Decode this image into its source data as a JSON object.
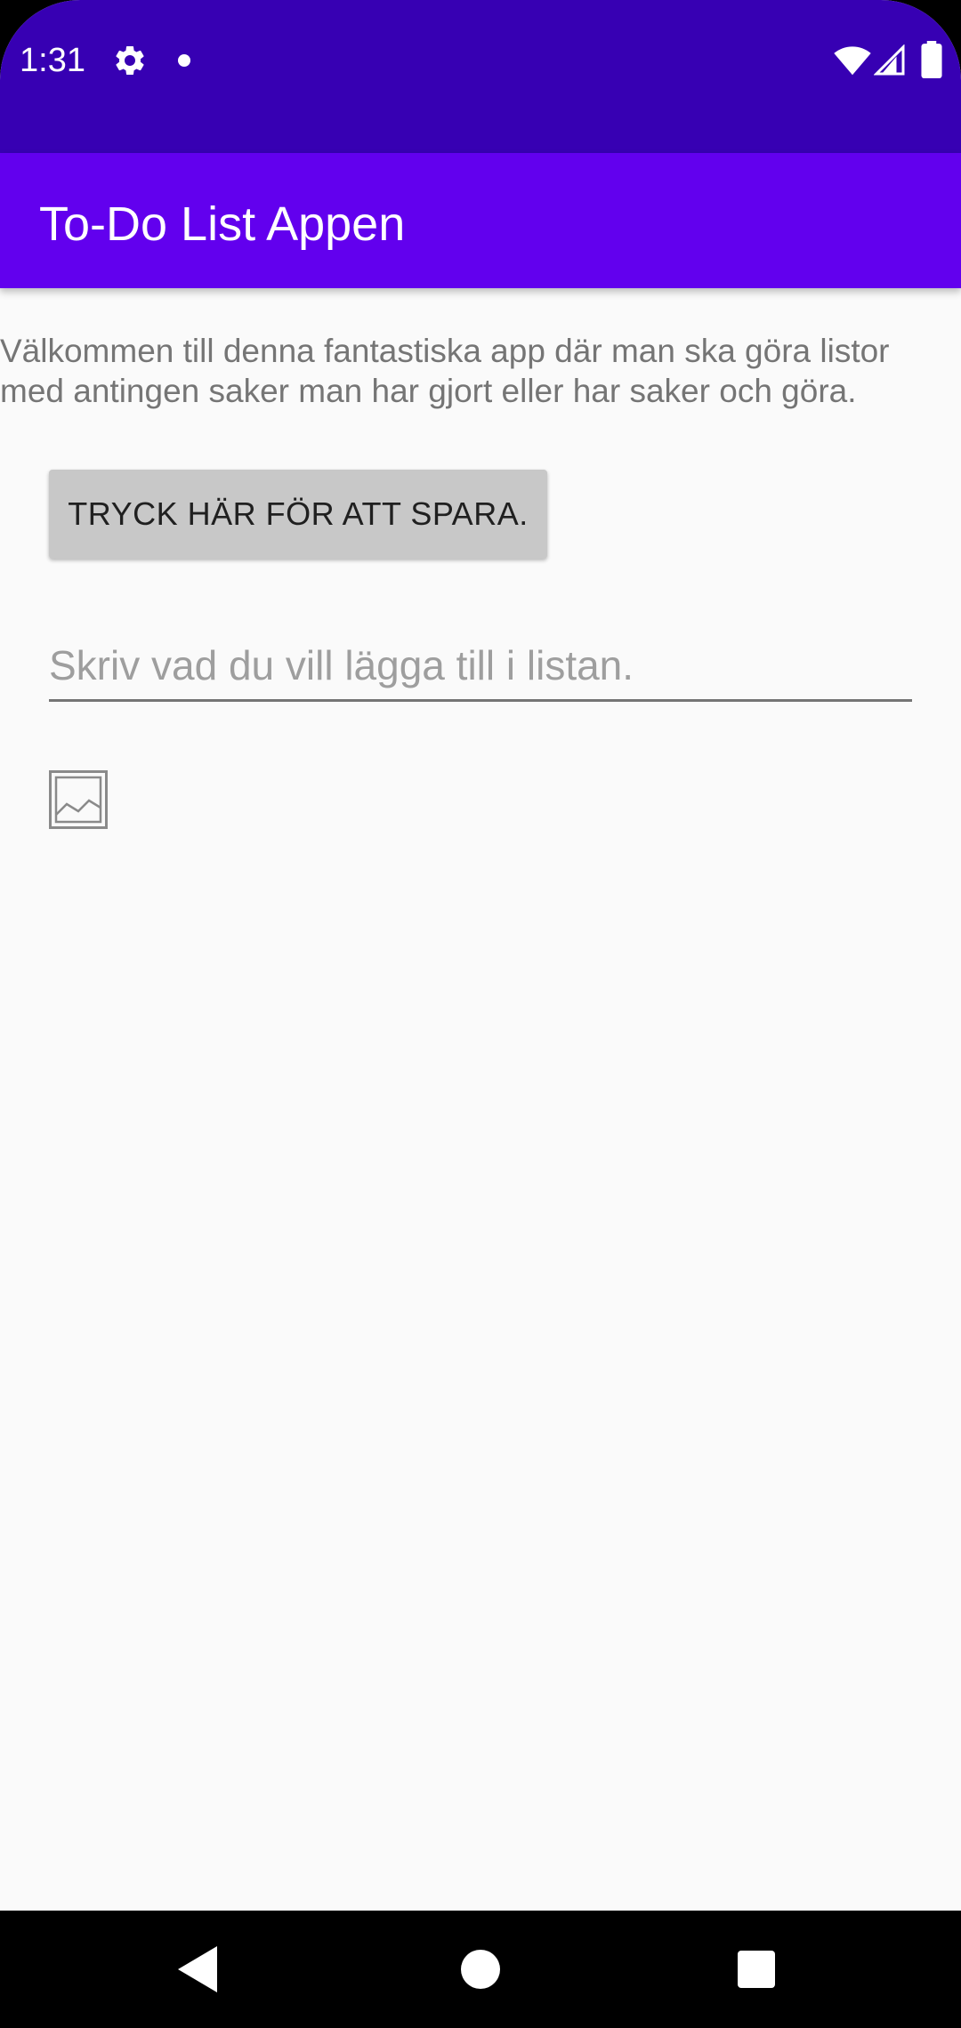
{
  "status_bar": {
    "time": "1:31",
    "icons": [
      "gear-icon",
      "notification-dot-icon",
      "wifi-icon",
      "cell-signal-icon",
      "battery-icon"
    ],
    "background": "#3700b3"
  },
  "app_bar": {
    "title": "To-Do List Appen",
    "background": "#6200ee"
  },
  "main": {
    "welcome_text": "Välkommen till denna fantastiska app där man ska göra listor med antingen saker man har gjort eller har saker och göra.",
    "save_button_label": "TRYCK HÄR FÖR ATT SPARA.",
    "todo_input": {
      "value": "",
      "placeholder": "Skriv vad du vill lägga till i listan."
    },
    "image_icon": "image-placeholder-icon"
  },
  "nav_bar": {
    "icons": [
      "back-icon",
      "home-icon",
      "recents-icon"
    ]
  }
}
